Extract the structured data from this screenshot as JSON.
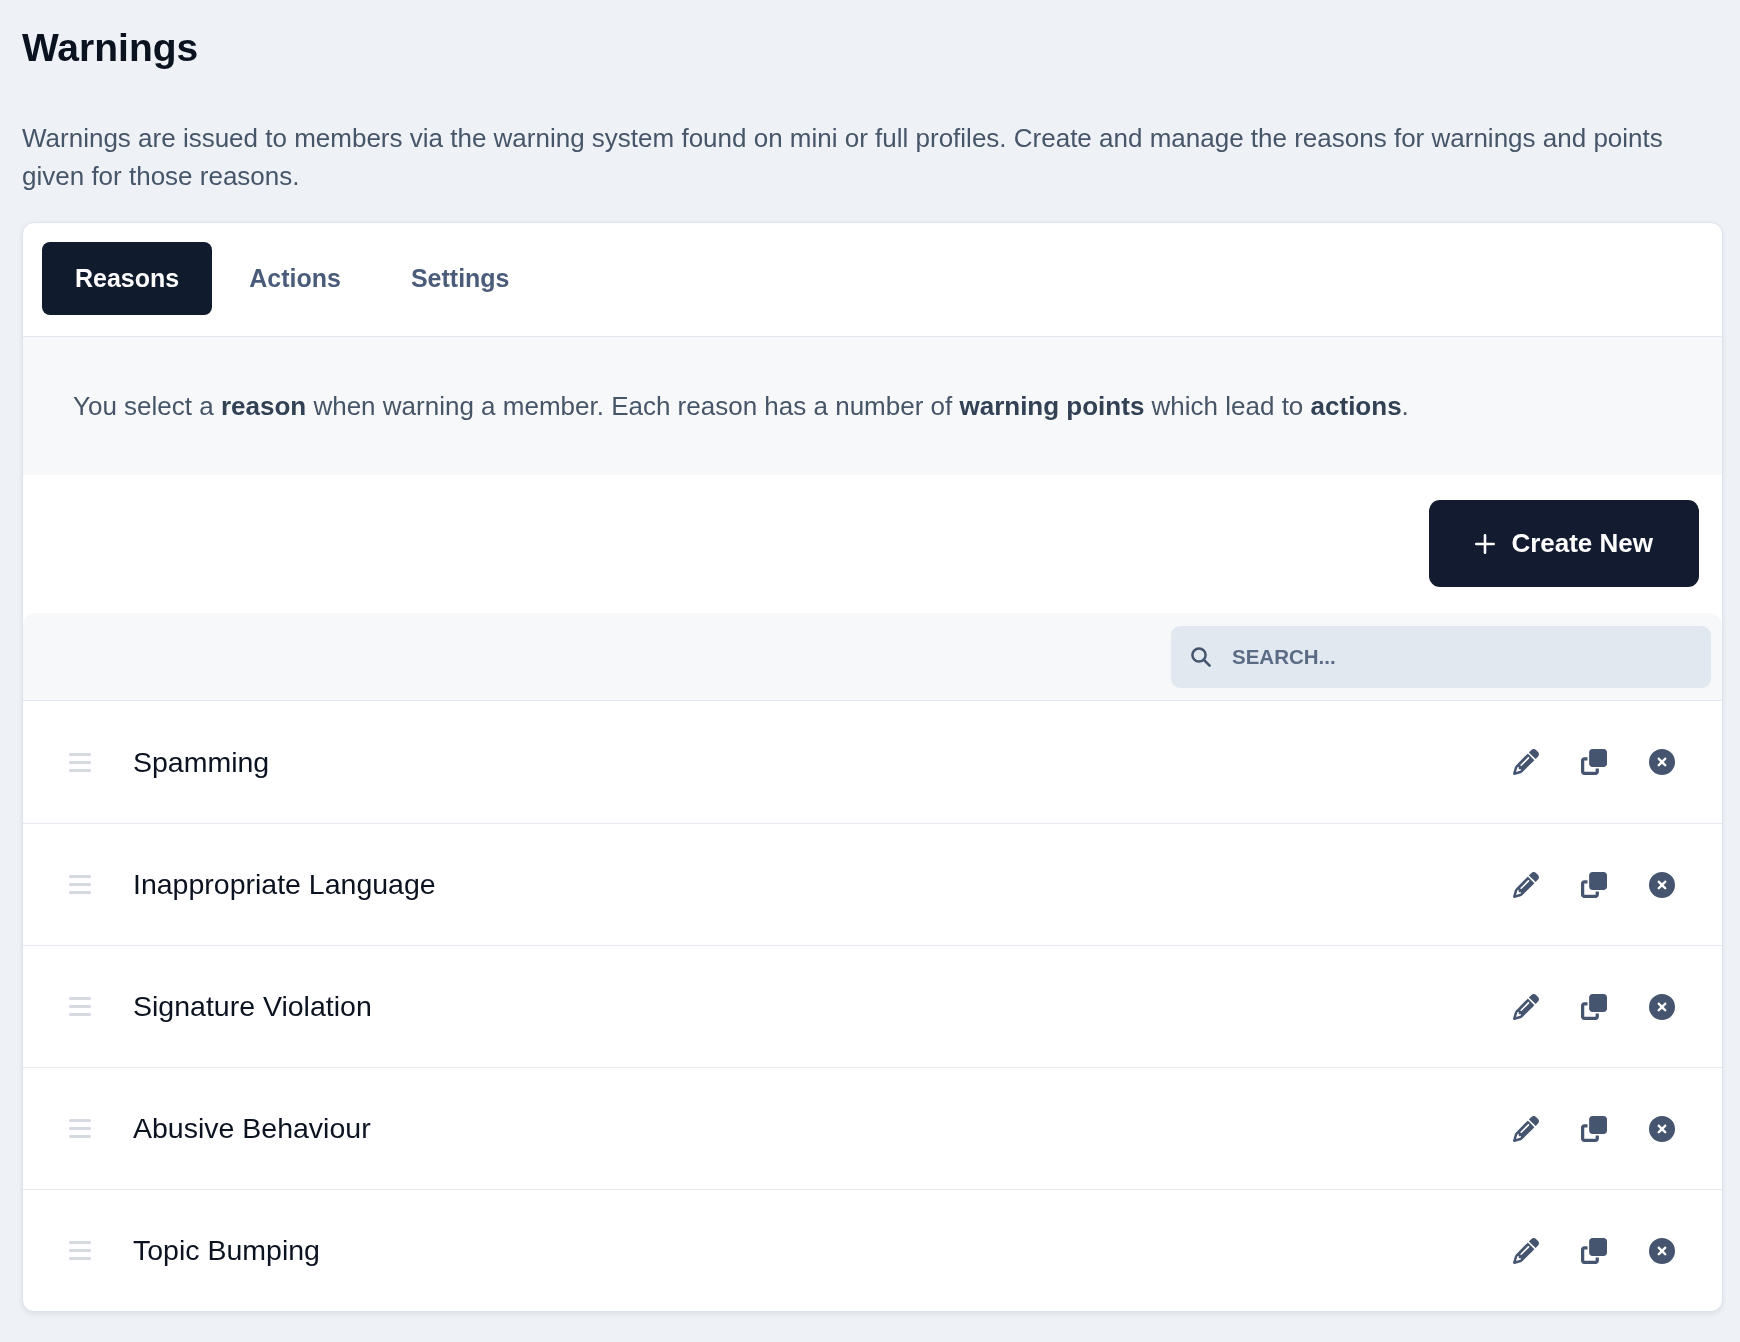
{
  "page": {
    "title": "Warnings",
    "description": "Warnings are issued to members via the warning system found on mini or full profiles. Create and manage the reasons for warnings and points given for those reasons."
  },
  "tabs": [
    {
      "label": "Reasons",
      "selected": true
    },
    {
      "label": "Actions",
      "selected": false
    },
    {
      "label": "Settings",
      "selected": false
    }
  ],
  "info_text": "You select a **reason** when warning a member. Each reason has a number of **warning points** which lead to **actions**.",
  "toolbar": {
    "create_button": "Create New"
  },
  "search": {
    "placeholder": "SEARCH..."
  },
  "reasons": [
    {
      "name": "Spamming"
    },
    {
      "name": "Inappropriate Language"
    },
    {
      "name": "Signature Violation"
    },
    {
      "name": "Abusive Behaviour"
    },
    {
      "name": "Topic Bumping"
    }
  ]
}
